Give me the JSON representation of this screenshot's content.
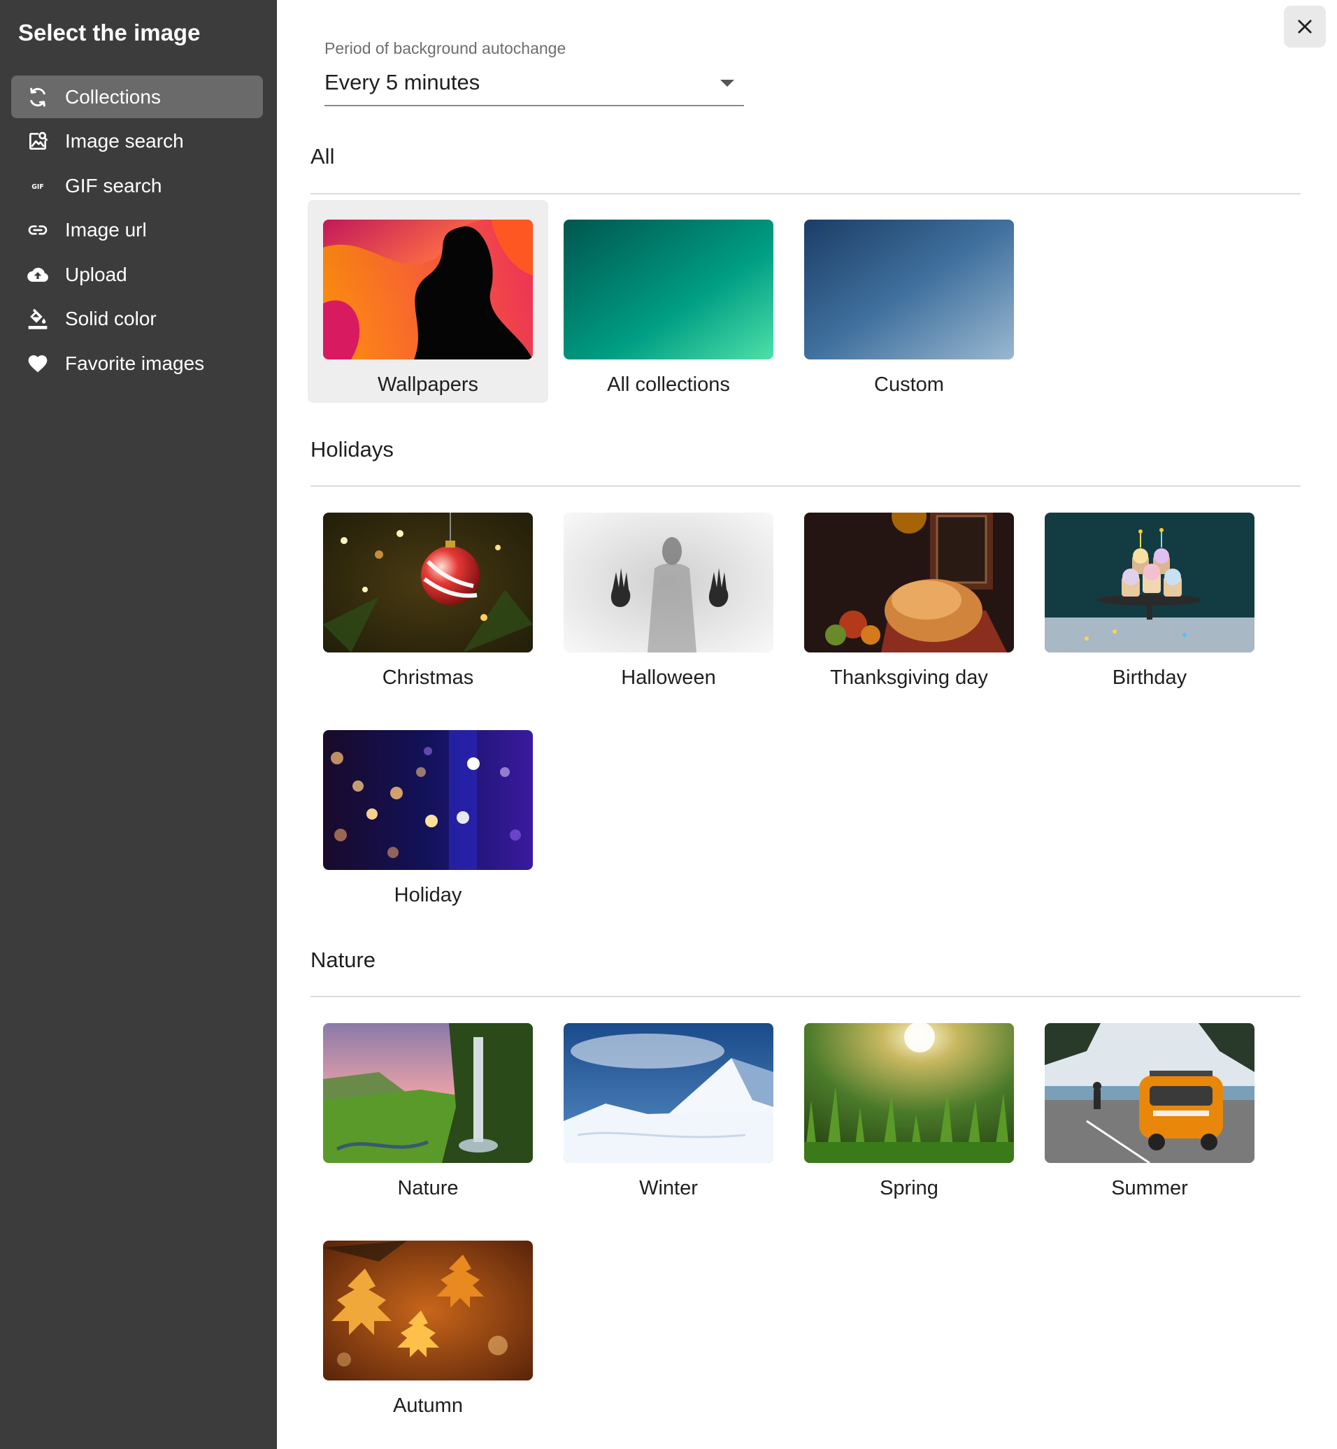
{
  "sidebar": {
    "title": "Select the image",
    "items": [
      {
        "label": "Collections",
        "icon": "refresh-icon"
      },
      {
        "label": "Image search",
        "icon": "image-search-icon"
      },
      {
        "label": "GIF search",
        "icon": "gif-icon"
      },
      {
        "label": "Image url",
        "icon": "link-icon"
      },
      {
        "label": "Upload",
        "icon": "cloud-upload-icon"
      },
      {
        "label": "Solid color",
        "icon": "paint-bucket-icon"
      },
      {
        "label": "Favorite images",
        "icon": "heart-icon"
      }
    ],
    "active_index": 0
  },
  "close_button": {
    "icon": "close-icon"
  },
  "period": {
    "label": "Period of background autochange",
    "value": "Every 5 minutes"
  },
  "sections": {
    "all": {
      "title": "All",
      "cards": [
        {
          "label": "Wallpapers",
          "selected": true
        },
        {
          "label": "All collections"
        },
        {
          "label": "Custom"
        }
      ]
    },
    "holidays": {
      "title": "Holidays",
      "cards": [
        {
          "label": "Christmas"
        },
        {
          "label": "Halloween"
        },
        {
          "label": "Thanksgiving day"
        },
        {
          "label": "Birthday"
        },
        {
          "label": "Holiday"
        }
      ]
    },
    "nature": {
      "title": "Nature",
      "cards": [
        {
          "label": "Nature"
        },
        {
          "label": "Winter"
        },
        {
          "label": "Spring"
        },
        {
          "label": "Summer"
        },
        {
          "label": "Autumn"
        }
      ]
    }
  },
  "colors": {
    "sidebar_bg": "#3c3c3c",
    "sidebar_active": "#6a6a6a",
    "selected_card_bg": "#eeeeee"
  }
}
